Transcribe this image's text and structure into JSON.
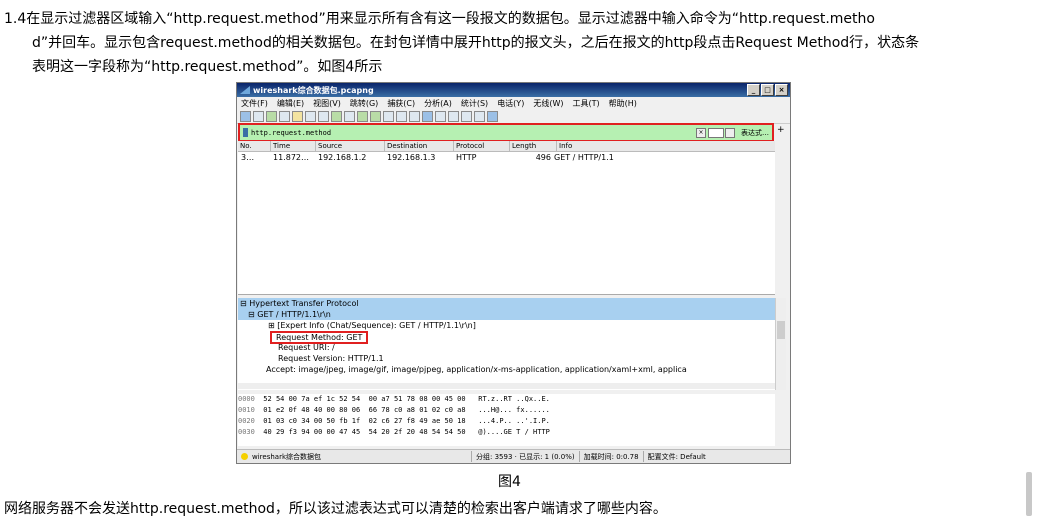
{
  "text": {
    "para_line1": "1.4在显示过滤器区域输入“http.request.method”用来显示所有含有这一段报文的数据包。显示过滤器中输入命令为“http.request.metho",
    "para_line2": "d”并回车。显示包含request.method的相关数据包。在封包详情中展开http的报文头，之后在报文的http段点击Request Method行，状态条",
    "para_line3": "表明这一字段称为“http.request.method”。如图4所示",
    "caption": "图4",
    "bottom": "网络服务器不会发送http.request.method，所以该过滤表达式可以清楚的检索出客户端请求了哪些内容。"
  },
  "wireshark": {
    "title": "wireshark综合数据包.pcapng",
    "controls": [
      "_",
      "□",
      "×"
    ],
    "menu": [
      "文件(F)",
      "编辑(E)",
      "视图(V)",
      "跳转(G)",
      "捕获(C)",
      "分析(A)",
      "统计(S)",
      "电话(Y)",
      "无线(W)",
      "工具(T)",
      "帮助(H)"
    ],
    "filter_value": "http.request.method",
    "filter_clear": "×",
    "expression_label": "表达式…",
    "plus": "+",
    "columns": [
      "No.",
      "Time",
      "Source",
      "Destination",
      "Protocol",
      "Length",
      "Info"
    ],
    "packet": {
      "no": "3…",
      "time": "11.872…",
      "source": "192.168.1.2",
      "destination": "192.168.1.3",
      "protocol": "HTTP",
      "length": "496",
      "info": "GET / HTTP/1.1"
    },
    "details": [
      "⊟ Hypertext Transfer Protocol",
      "⊟ GET / HTTP/1.1\\r\\n",
      "⊞ [Expert Info (Chat/Sequence): GET / HTTP/1.1\\r\\n]",
      "Request Method: GET",
      "Request URI: /",
      "Request Version: HTTP/1.1",
      "Accept: image/jpeg, image/gif, image/pjpeg, application/x-ms-application, application/xaml+xml, applica"
    ],
    "hex": [
      {
        "off": "0000",
        "bytes": "52 54 00 7a ef 1c 52 54  00 a7 51 78 08 00 45 00",
        "ascii": "RT.z..RT ..Qx..E."
      },
      {
        "off": "0010",
        "bytes": "01 e2 0f 48 40 00 80 06  66 78 c0 a8 01 02 c0 a8",
        "ascii": "...H@... fx......"
      },
      {
        "off": "0020",
        "bytes": "01 03 c0 34 00 50 fb 1f  02 c6 27 f8 49 ae 50 18",
        "ascii": "...4.P.. ..'.I.P."
      },
      {
        "off": "0030",
        "bytes": "40 29 f3 94 00 00 47 45  54 20 2f 20 48 54 54 50",
        "ascii": "@)....GE T / HTTP"
      }
    ],
    "status": {
      "file": "wireshark综合数据包",
      "group": "分组: 3593 · 已显示: 1 (0.0%)",
      "load": "加载时间: 0:0.78",
      "profile": "配置文件: Default"
    }
  }
}
